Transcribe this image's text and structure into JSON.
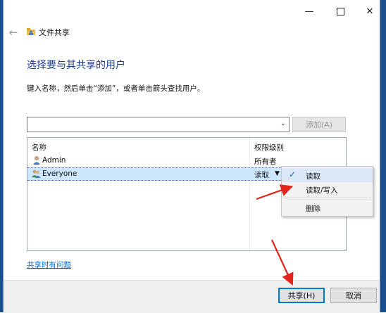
{
  "app": {
    "title": "文件共享",
    "back_icon": "arrow-left-icon"
  },
  "window": {
    "minimize_icon": "minimize-icon",
    "maximize_icon": "maximize-icon",
    "close_icon": "close-icon"
  },
  "main": {
    "heading": "选择要与其共享的用户",
    "instruction": "键入名称，然后单击“添加”，或者单击箭头查找用户。",
    "combo_value": "",
    "add_label": "添加(A)"
  },
  "table": {
    "headers": {
      "name": "名称",
      "permission": "权限级别"
    },
    "rows": [
      {
        "name": "Admin",
        "permission": "所有者",
        "icon": "user-icon"
      },
      {
        "name": "Everyone",
        "permission": "读取",
        "icon": "group-icon"
      }
    ]
  },
  "permission_menu": {
    "items": [
      {
        "label": "读取",
        "checked": true
      },
      {
        "label": "读取/写入",
        "checked": false
      },
      {
        "label": "删除",
        "checked": false
      }
    ]
  },
  "help_link": "共享时有问题",
  "buttons": {
    "share": "共享(H)",
    "cancel": "取消"
  },
  "colors": {
    "heading": "#1e3f91",
    "accent": "#0078d7",
    "selection": "#cce8ff",
    "annotation_arrow": "#e3241b"
  }
}
